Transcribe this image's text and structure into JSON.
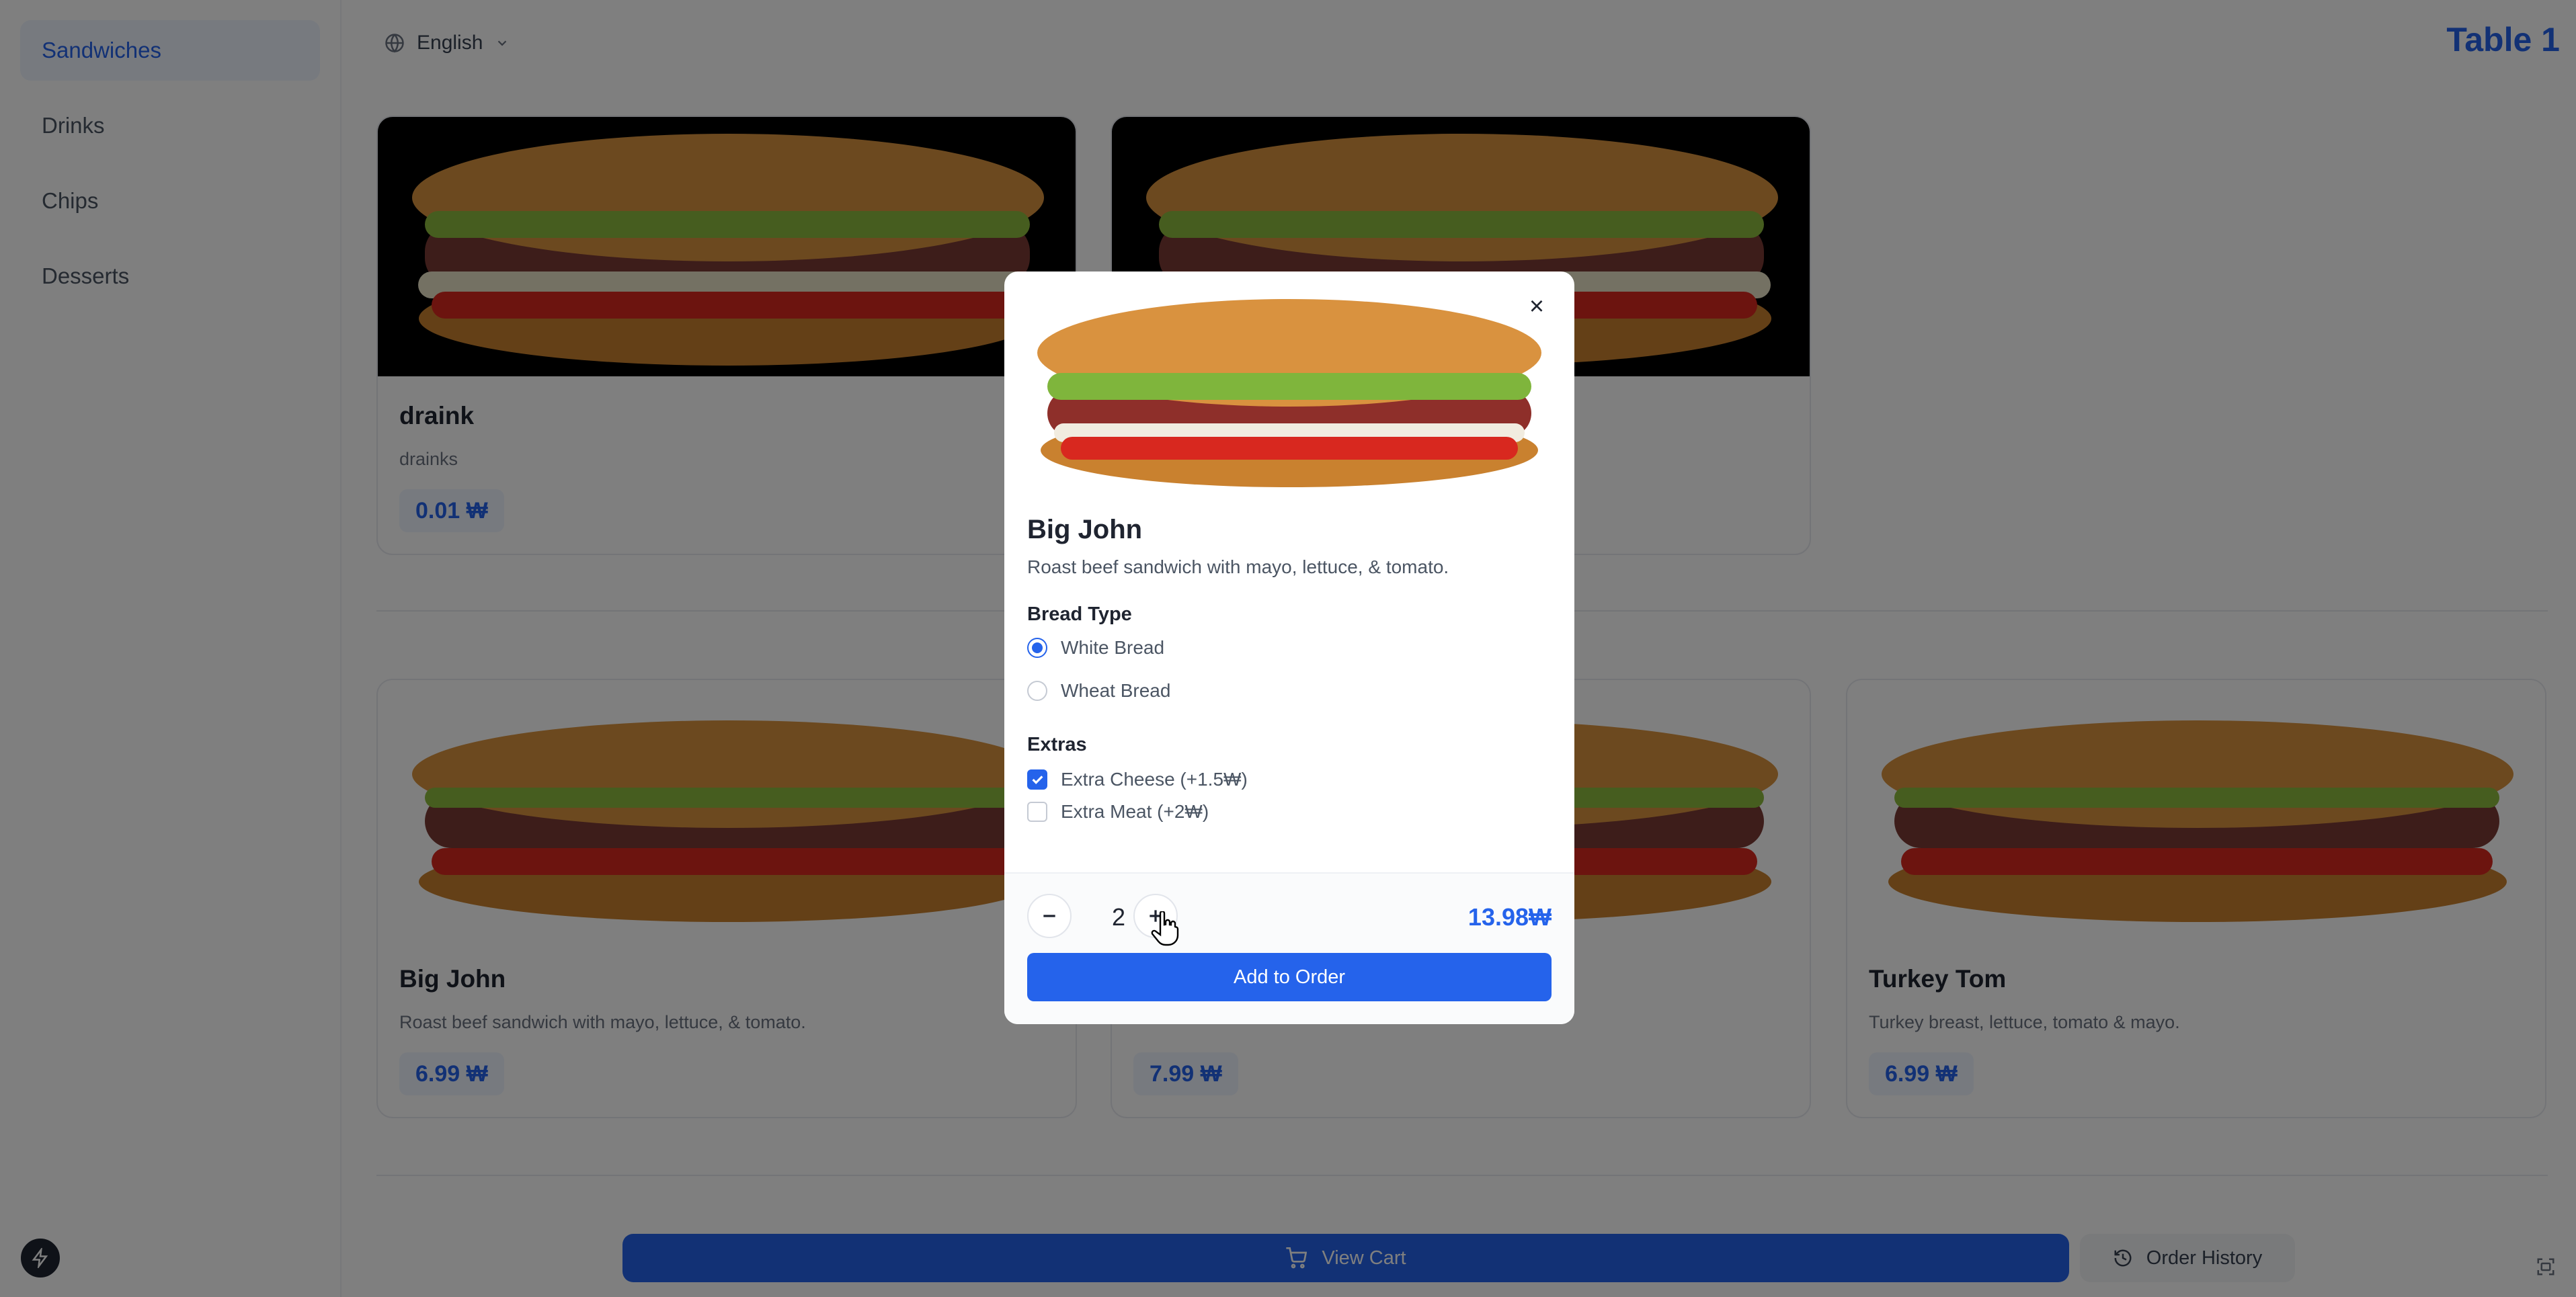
{
  "sidebar": {
    "items": [
      {
        "label": "Sandwiches"
      },
      {
        "label": "Drinks"
      },
      {
        "label": "Chips"
      },
      {
        "label": "Desserts"
      }
    ]
  },
  "header": {
    "language": "English",
    "table": "Table 1"
  },
  "drinks_section": {
    "cards": [
      {
        "title": "draink",
        "description": "drainks",
        "price": "0.01 ₩"
      }
    ]
  },
  "sandwiches_section": {
    "cards": [
      {
        "title": "Big John",
        "description": "Roast beef sandwich with mayo, lettuce, & tomato.",
        "price": "6.99 ₩"
      },
      {
        "title": "",
        "description": "",
        "price": "7.99 ₩"
      },
      {
        "title": "Turkey Tom",
        "description": "Turkey breast, lettuce, tomato & mayo.",
        "price": "6.99 ₩"
      }
    ]
  },
  "bottom_bar": {
    "view_cart": "View Cart",
    "order_history": "Order History"
  },
  "modal": {
    "title": "Big John",
    "description": "Roast beef sandwich with mayo, lettuce, & tomato.",
    "bread_type_label": "Bread Type",
    "bread_options": [
      {
        "label": "White Bread",
        "selected": true
      },
      {
        "label": "Wheat Bread",
        "selected": false
      }
    ],
    "extras_label": "Extras",
    "extras": [
      {
        "label": "Extra Cheese (+1.5₩)",
        "checked": true
      },
      {
        "label": "Extra Meat (+2₩)",
        "checked": false
      }
    ],
    "quantity": "2",
    "total": "13.98₩",
    "add_button": "Add to Order"
  },
  "colors": {
    "accent": "#2563eb",
    "overlay": "rgba(0,0,0,0.5)"
  }
}
